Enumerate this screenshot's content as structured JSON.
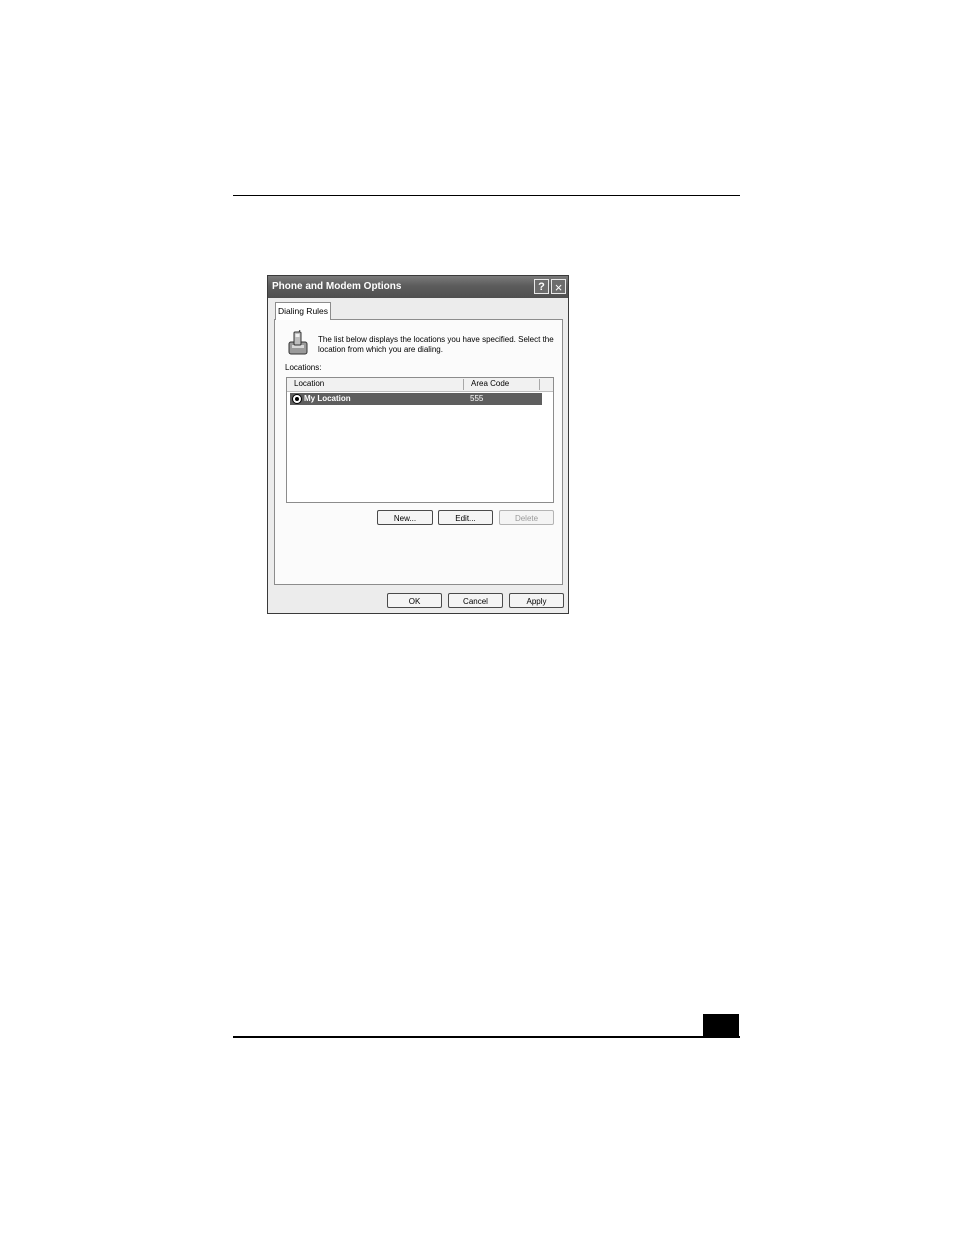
{
  "dialog": {
    "title": "Phone and Modem Options",
    "help_glyph": "?",
    "close_glyph": "×",
    "tab_label": "Dialing Rules",
    "description": "The list below displays the locations you have specified. Select the location from which you are dialing.",
    "locations_label": "Locations:",
    "columns": {
      "location": "Location",
      "area_code": "Area Code"
    },
    "rows": [
      {
        "location": "My Location",
        "area_code": "555",
        "selected": true
      }
    ],
    "buttons": {
      "new": "New...",
      "edit": "Edit...",
      "delete": "Delete",
      "ok": "OK",
      "cancel": "Cancel",
      "apply": "Apply"
    }
  },
  "icons": {
    "phone": "phone-icon",
    "current_location": "current-location-icon"
  }
}
